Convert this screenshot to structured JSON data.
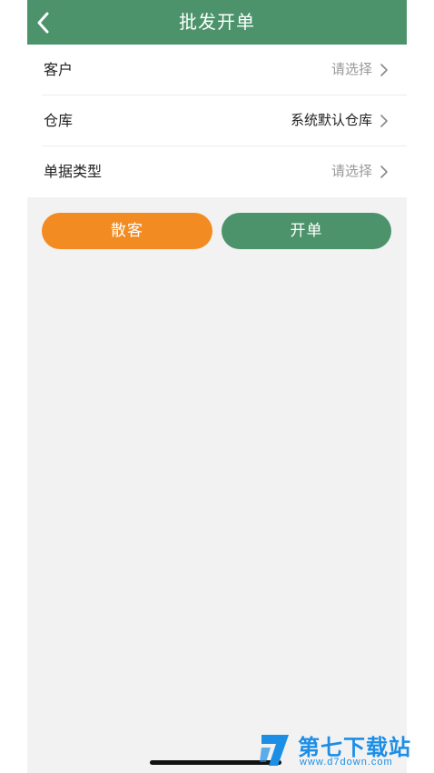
{
  "header": {
    "title": "批发开单",
    "back_icon": "chevron-left-icon"
  },
  "form": {
    "rows": [
      {
        "label": "客户",
        "value": "请选择",
        "is_placeholder": true
      },
      {
        "label": "仓库",
        "value": "系统默认仓库",
        "is_placeholder": false
      },
      {
        "label": "单据类型",
        "value": "请选择",
        "is_placeholder": true
      }
    ]
  },
  "actions": {
    "walkin_label": "散客",
    "open_label": "开单"
  },
  "watermark": {
    "name": "第七下载站",
    "url": "www.d7down.com"
  },
  "colors": {
    "header_bg": "#4c936c",
    "walkin_button": "#f28b22",
    "open_button": "#4c936c",
    "page_bg": "#f2f2f2"
  }
}
